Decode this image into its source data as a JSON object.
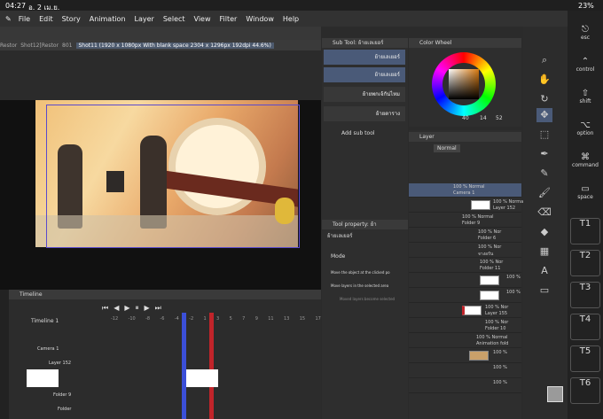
{
  "status": {
    "time": "04:27",
    "date": "อ. 2 เม.ย.",
    "battery": "23%"
  },
  "menu": [
    "File",
    "Edit",
    "Story",
    "Animation",
    "Layer",
    "Select",
    "View",
    "Filter",
    "Window",
    "Help"
  ],
  "tabs": [
    "Restor",
    "Shot12[Restor",
    "801",
    "Shot11 (1920 x 1080px With blank space 2304 x 1296px 192dpi 44.6%)"
  ],
  "subtool": {
    "title": "Sub Tool: ย้ายเลเยอร์",
    "items": [
      "ย้ายเลเยอร์",
      "ย้ายเลเยอร์",
      "ย้ายพกเจ้กัน่ไหม",
      "ย้ายตาราง"
    ],
    "add": "Add sub tool"
  },
  "property": {
    "title": "Tool property: ย้า",
    "name": "ย้ายเลเยอร์",
    "mode": "Mode",
    "opt1": "Move the object at the clicked po",
    "opt2": "Move layers in the selected area",
    "opt3": "Moved layers become selected"
  },
  "colorwheel": {
    "title": "Color Wheel",
    "v1": "40",
    "v2": "14",
    "v3": "52"
  },
  "layer": {
    "title": "Layer",
    "blend": "Normal",
    "rows": [
      {
        "a": "100 %  Normal",
        "b": "Camera 1"
      },
      {
        "a": "100 %  Normal",
        "b": "Layer 152"
      },
      {
        "a": "100 %  Normal",
        "b": "Folder 9"
      },
      {
        "a": "100 %  Nor",
        "b": "Folder 6"
      },
      {
        "a": "100 %  Nor",
        "b": "จางอรัน"
      },
      {
        "a": "100 %  Nor",
        "b": "Folder 11"
      },
      {
        "a": "100 %",
        "b": ""
      },
      {
        "a": "100 %",
        "b": ""
      },
      {
        "a": "100 %  Nor",
        "b": "Layer 155"
      },
      {
        "a": "100 %  Nor",
        "b": "Folder 10"
      },
      {
        "a": "100 %  Normal",
        "b": "Animation fold"
      },
      {
        "a": "100 %",
        "b": ""
      },
      {
        "a": "100 %",
        "b": ""
      },
      {
        "a": "100 %",
        "b": ""
      }
    ]
  },
  "timeline": {
    "title": "Timeline",
    "name": "Timeline 1",
    "frames": [
      "-12",
      "-10",
      "-8",
      "-6",
      "-4",
      "-2",
      "1",
      "3",
      "5",
      "7",
      "9",
      "11",
      "13",
      "15",
      "17"
    ],
    "rows": [
      "",
      "Camera 1",
      "Layer 152",
      "",
      "Folder 9",
      "Folder"
    ]
  },
  "keys": [
    {
      "g": "⎋",
      "l": "esc"
    },
    {
      "g": "⌃",
      "l": "control"
    },
    {
      "g": "⇧",
      "l": "shift"
    },
    {
      "g": "⌥",
      "l": "option"
    },
    {
      "g": "⌘",
      "l": "command"
    },
    {
      "g": "▭",
      "l": "space"
    },
    {
      "g": "T1",
      "l": ""
    },
    {
      "g": "T2",
      "l": ""
    },
    {
      "g": "T3",
      "l": ""
    },
    {
      "g": "T4",
      "l": ""
    },
    {
      "g": "T5",
      "l": ""
    },
    {
      "g": "T6",
      "l": ""
    }
  ]
}
